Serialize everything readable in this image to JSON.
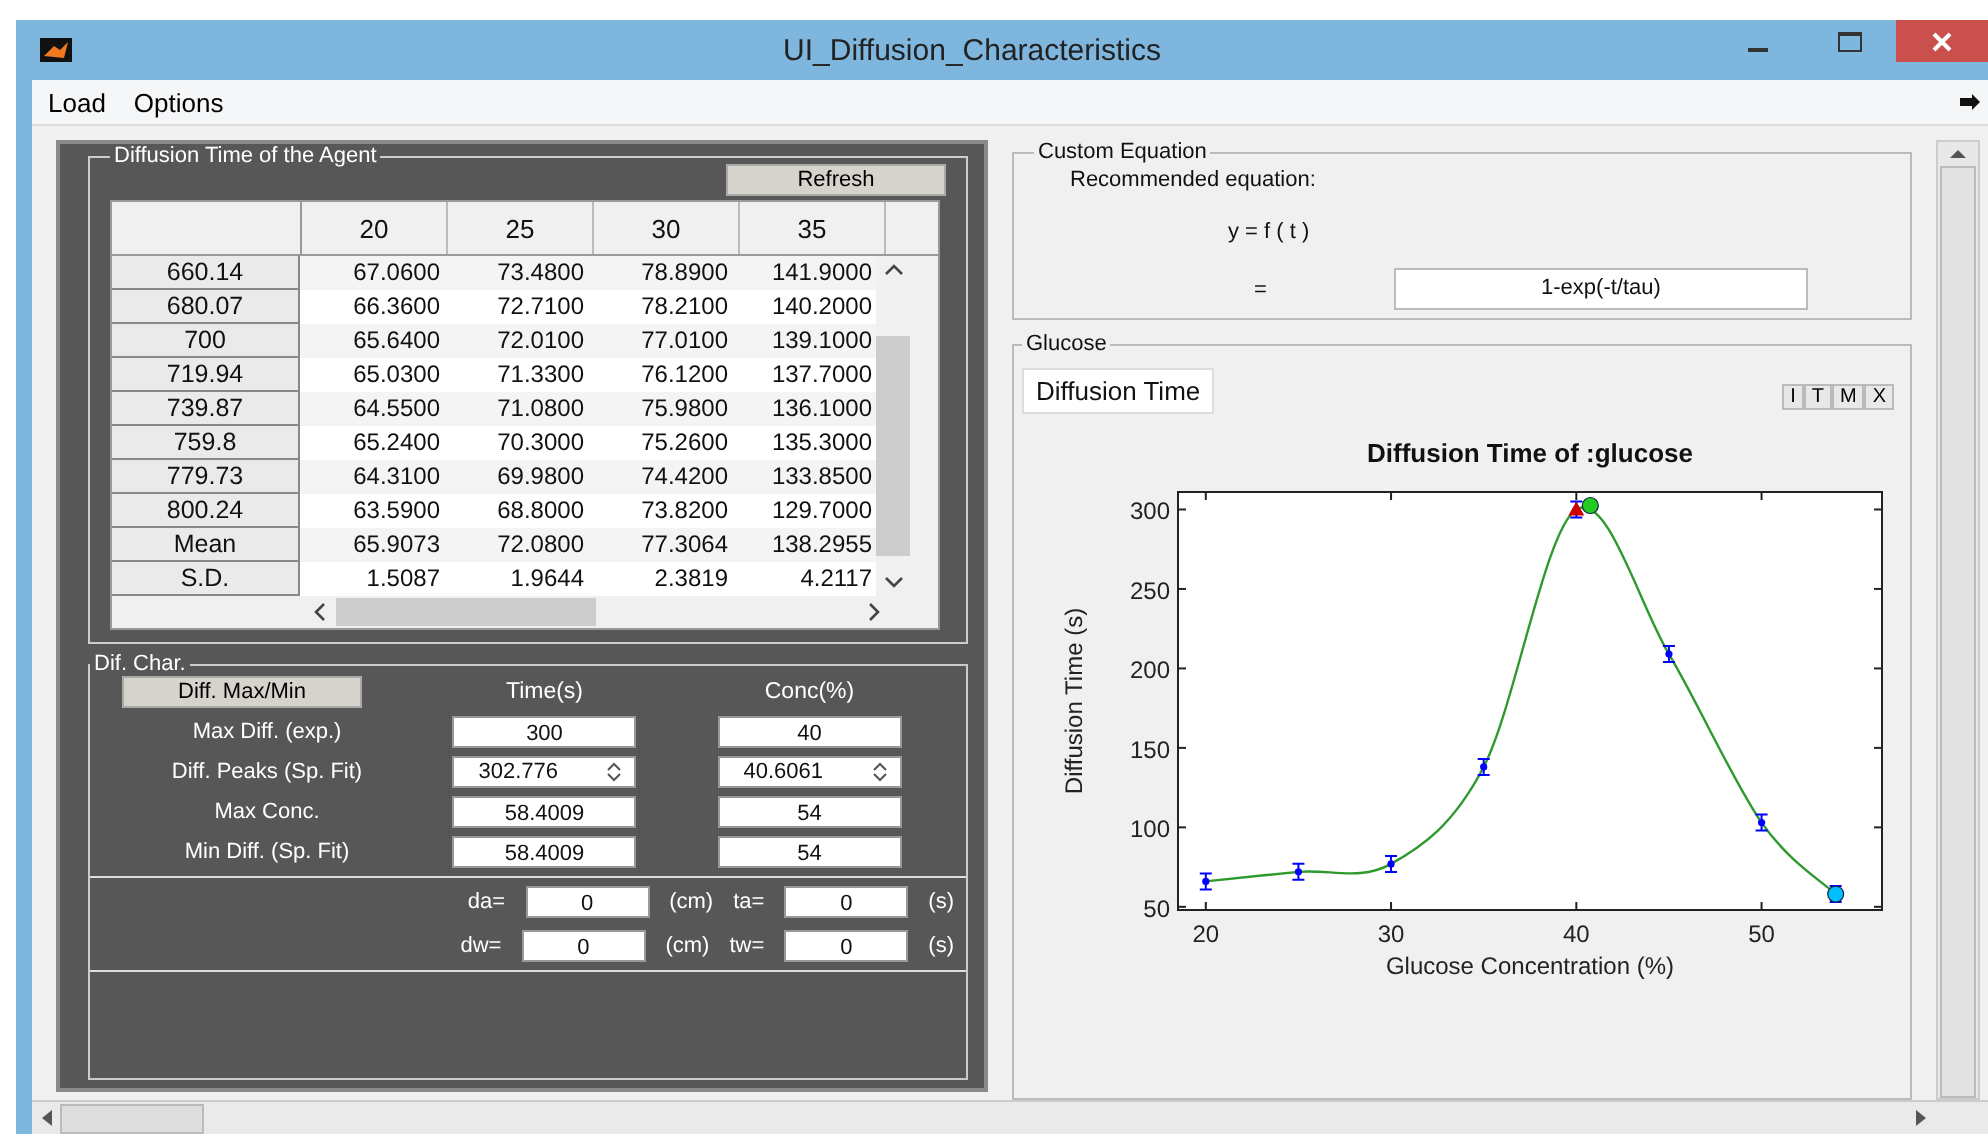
{
  "window": {
    "title": "UI_Diffusion_Characteristics"
  },
  "menu": [
    "Load",
    "Options"
  ],
  "agent_table": {
    "title": "Diffusion Time of the Agent",
    "refresh": "Refresh",
    "columns": [
      "20",
      "25",
      "30",
      "35"
    ],
    "rows": [
      {
        "label": "660.14",
        "cells": [
          "67.0600",
          "73.4800",
          "78.8900",
          "141.9000"
        ]
      },
      {
        "label": "680.07",
        "cells": [
          "66.3600",
          "72.7100",
          "78.2100",
          "140.2000"
        ]
      },
      {
        "label": "700",
        "cells": [
          "65.6400",
          "72.0100",
          "77.0100",
          "139.1000"
        ]
      },
      {
        "label": "719.94",
        "cells": [
          "65.0300",
          "71.3300",
          "76.1200",
          "137.7000"
        ]
      },
      {
        "label": "739.87",
        "cells": [
          "64.5500",
          "71.0800",
          "75.9800",
          "136.1000"
        ]
      },
      {
        "label": "759.8",
        "cells": [
          "65.2400",
          "70.3000",
          "75.2600",
          "135.3000"
        ]
      },
      {
        "label": "779.73",
        "cells": [
          "64.3100",
          "69.9800",
          "74.4200",
          "133.8500"
        ]
      },
      {
        "label": "800.24",
        "cells": [
          "63.5900",
          "68.8000",
          "73.8200",
          "129.7000"
        ]
      },
      {
        "label": "Mean",
        "cells": [
          "65.9073",
          "72.0800",
          "77.3064",
          "138.2955"
        ]
      },
      {
        "label": "S.D.",
        "cells": [
          "1.5087",
          "1.9644",
          "2.3819",
          "4.2117"
        ]
      }
    ]
  },
  "dif_char": {
    "title": "Dif. Char.",
    "button": "Diff. Max/Min",
    "col_time": "Time(s)",
    "col_conc": "Conc(%)",
    "rows": [
      {
        "label": "Max Diff. (exp.)",
        "kind": "text",
        "time": "300",
        "conc": "40"
      },
      {
        "label": "Diff. Peaks (Sp. Fit)",
        "kind": "spinner",
        "time": "302.776",
        "conc": "40.6061"
      },
      {
        "label": "Max Conc.",
        "kind": "text",
        "time": "58.4009",
        "conc": "54"
      },
      {
        "label": "Min Diff. (Sp. Fit)",
        "kind": "text",
        "time": "58.4009",
        "conc": "54"
      }
    ],
    "params": [
      {
        "label": "da=",
        "value": "0",
        "unit": "(cm)",
        "label2": "ta=",
        "value2": "0",
        "unit2": "(s)"
      },
      {
        "label": "dw=",
        "value": "0",
        "unit": "(cm)",
        "label2": "tw=",
        "value2": "0",
        "unit2": "(s)"
      }
    ]
  },
  "custom_equation": {
    "title": "Custom Equation",
    "recommended": "Recommended equation:",
    "formula": "y = f ( t )",
    "equals": "=",
    "value": "1-exp(-t/tau)"
  },
  "glucose": {
    "title": "Glucose",
    "tab": "Diffusion Time",
    "tools": [
      "I",
      "T",
      "M",
      "X"
    ],
    "chart_data": {
      "type": "line",
      "title": "Diffusion Time of :glucose",
      "xlabel": "Glucose Concentration (%)",
      "ylabel": "Diffusion Time (s)",
      "x": [
        20,
        25,
        30,
        35,
        40,
        45,
        50,
        54
      ],
      "series": [
        {
          "color": "#2e9a2e",
          "marker": "cross",
          "values": [
            66,
            72,
            77,
            138,
            300,
            209,
            103,
            58
          ]
        }
      ],
      "xlim": [
        18.5,
        56.5
      ],
      "ylim": [
        48,
        311
      ],
      "xticks": [
        20,
        30,
        40,
        50
      ],
      "yticks": [
        50,
        100,
        150,
        200,
        250,
        300
      ]
    }
  }
}
